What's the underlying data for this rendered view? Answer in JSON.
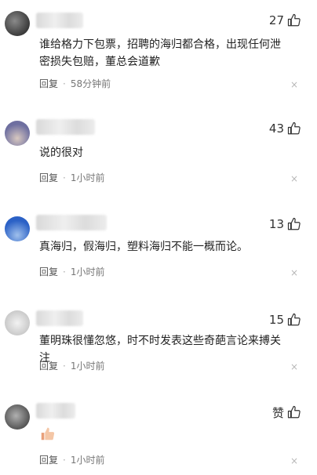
{
  "comments": [
    {
      "likes": "27",
      "text": "谁给格力下包票，招聘的海归都合格，出现任何泄密损失包赔，董总会道歉",
      "reply_label": "回复",
      "time": "58分钟前",
      "close": "×",
      "avatar_colors": [
        "#3b3b3b",
        "#8a8a8a"
      ]
    },
    {
      "likes": "43",
      "text": "说的很对",
      "reply_label": "回复",
      "time": "1小时前",
      "close": "×",
      "avatar_colors": [
        "#6e6fa0",
        "#d8c8c0"
      ]
    },
    {
      "likes": "13",
      "text": "真海归，假海归，塑料海归不能一概而论。",
      "reply_label": "回复",
      "time": "1小时前",
      "close": "×",
      "avatar_colors": [
        "#2b61c6",
        "#9fc0ec"
      ]
    },
    {
      "likes": "15",
      "text": "董明珠很懂忽悠，时不时发表这些奇葩言论来搏关注",
      "reply_label": "回复",
      "time": "1小时前",
      "close": "×",
      "avatar_colors": [
        "#f2f2f2",
        "#c7c7c7"
      ]
    },
    {
      "likes": "赞",
      "text": "",
      "reply_label": "回复",
      "time": "1小时前",
      "close": "×",
      "avatar_colors": [
        "#555555",
        "#b0b0b0"
      ]
    }
  ]
}
